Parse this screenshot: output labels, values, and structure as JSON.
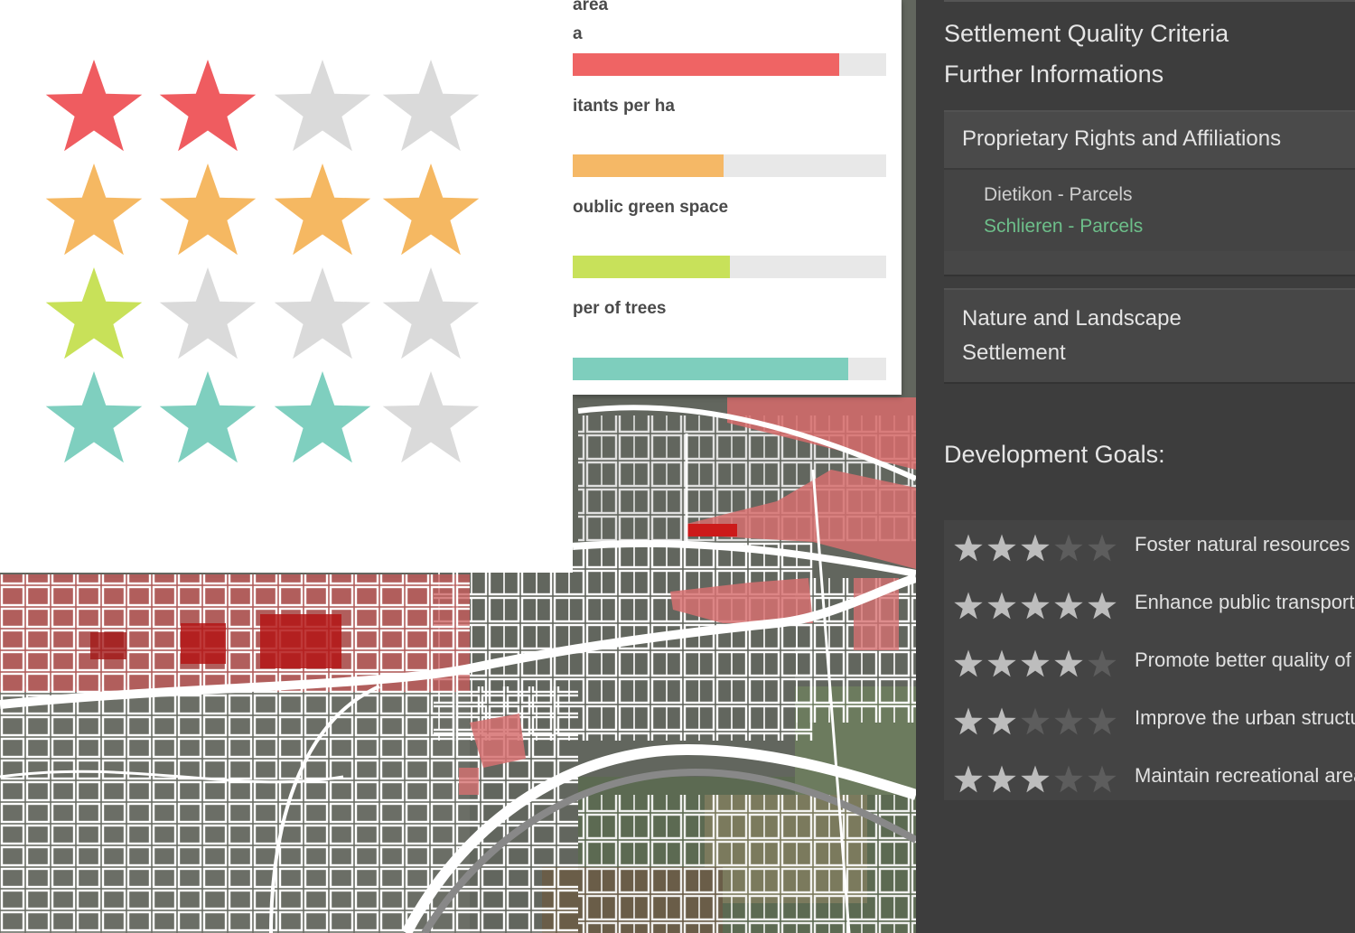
{
  "bars_panel": {
    "items": [
      {
        "label": "area",
        "label_line2": "a",
        "value": 0.85,
        "color": "#ef6464"
      },
      {
        "label": "itants per ha",
        "value": 0.48,
        "color": "#f5b866"
      },
      {
        "label": "oublic green space",
        "value": 0.5,
        "color": "#c8e15a"
      },
      {
        "label": "per of trees",
        "value": 0.88,
        "color": "#7ecebd"
      }
    ]
  },
  "star_legend": {
    "rows": [
      {
        "color": "#ef5c60",
        "filled": 2,
        "total": 4
      },
      {
        "color": "#f5b862",
        "filled": 4,
        "total": 4
      },
      {
        "color": "#c8e159",
        "filled": 1,
        "total": 4
      },
      {
        "color": "#7fcfbf",
        "filled": 3,
        "total": 4
      }
    ],
    "empty_color": "#dadada"
  },
  "side_panel": {
    "criteria_heading": "Settlement Quality Criteria",
    "further_heading": "Further Informations",
    "proprietary": {
      "title": "Proprietary Rights and Affiliations",
      "links": [
        {
          "label": "Dietikon - Parcels",
          "color": "#cfcfcf"
        },
        {
          "label": "Schlieren - Parcels",
          "color": "#6dbf8a"
        }
      ]
    },
    "nature": {
      "title_line1": "Nature and Landscape",
      "title_line2": "Settlement"
    },
    "goals_heading": "Development Goals:",
    "goals": [
      {
        "label": "Foster natural resources",
        "rating": 3
      },
      {
        "label": "Enhance public transport",
        "rating": 5
      },
      {
        "label": "Promote better quality of",
        "rating": 4
      },
      {
        "label": "Improve the urban structu",
        "rating": 2
      },
      {
        "label": "Maintain recreational area",
        "rating": 3
      }
    ],
    "star_on_color": "#bdbdbd",
    "star_off_color": "#5d5d5d"
  }
}
